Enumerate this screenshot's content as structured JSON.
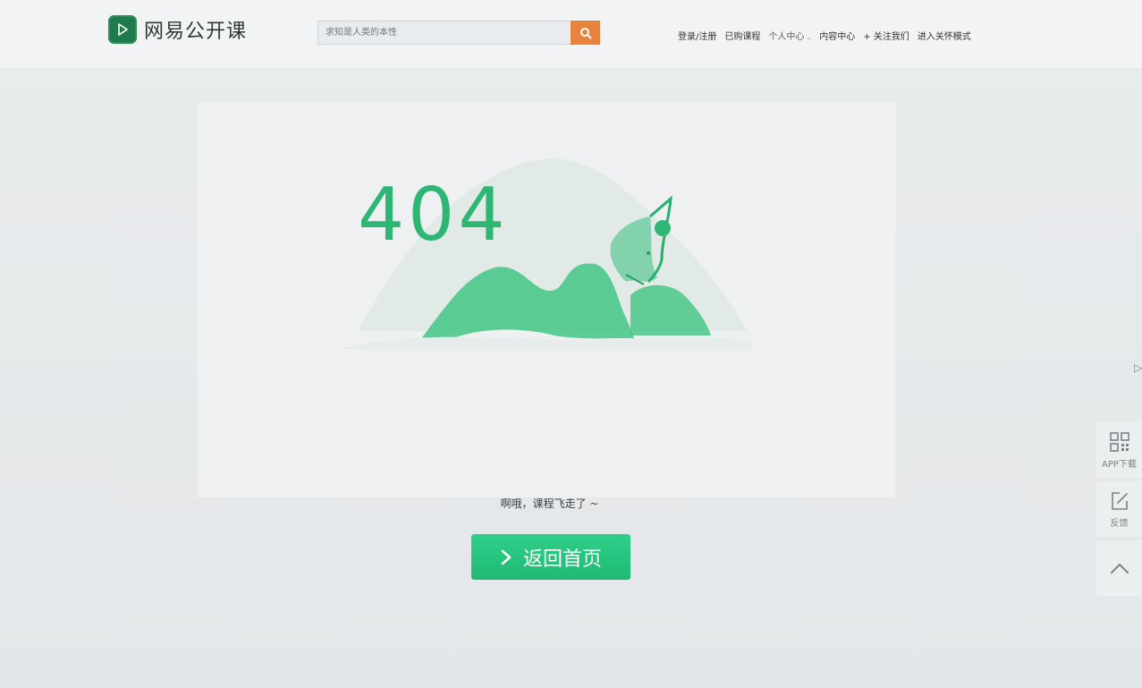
{
  "header": {
    "logo_text": "网易公开课",
    "search_placeholder": "求知是人类的本性",
    "nav": {
      "login": "登录/注册",
      "purchased": "已购课程",
      "personal": "个人中心",
      "content": "内容中心",
      "follow": "+ 关注我们",
      "care_mode": "进入关怀模式"
    }
  },
  "main": {
    "error_code": "404",
    "message": "啊哦，课程飞走了 ~",
    "home_button": "返回首页"
  },
  "rail": {
    "app_download": "APP下载",
    "feedback": "反馈"
  },
  "colors": {
    "brand_green": "#2db674",
    "button_green": "#20ba74",
    "search_orange": "#e8833d"
  },
  "icons": [
    "play-icon",
    "search-icon",
    "chevron-right-icon",
    "qr-code-icon",
    "edit-icon",
    "chevron-up-icon"
  ]
}
